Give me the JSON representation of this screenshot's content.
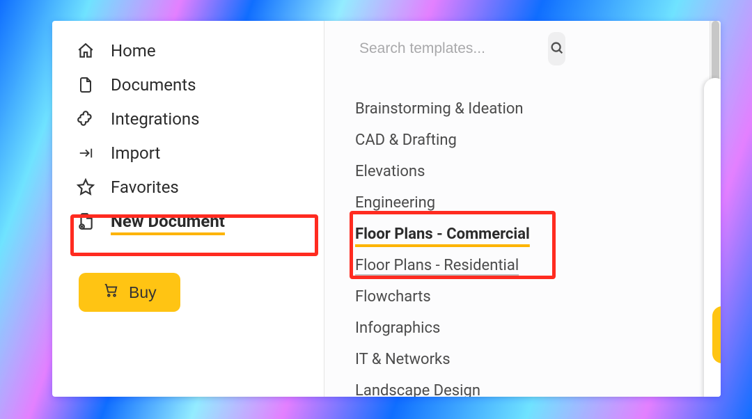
{
  "sidebar": {
    "items": [
      {
        "label": "Home",
        "icon": "home-icon"
      },
      {
        "label": "Documents",
        "icon": "documents-icon"
      },
      {
        "label": "Integrations",
        "icon": "integrations-icon"
      },
      {
        "label": "Import",
        "icon": "import-icon"
      },
      {
        "label": "Favorites",
        "icon": "favorites-icon"
      },
      {
        "label": "New Document",
        "icon": "new-document-icon",
        "active": true
      }
    ],
    "buy_label": "Buy"
  },
  "search": {
    "placeholder": "Search templates..."
  },
  "categories": [
    {
      "label": "Brainstorming & Ideation"
    },
    {
      "label": "CAD & Drafting"
    },
    {
      "label": "Elevations"
    },
    {
      "label": "Engineering"
    },
    {
      "label": "Floor Plans - Commercial",
      "active": true
    },
    {
      "label": "Floor Plans - Residential",
      "sub_underlined": true
    },
    {
      "label": "Flowcharts"
    },
    {
      "label": "Infographics"
    },
    {
      "label": "IT & Networks"
    },
    {
      "label": "Landscape Design"
    }
  ],
  "highlights": {
    "sidebar_box_on": "New Document",
    "category_box_on": [
      "Floor Plans - Commercial",
      "Floor Plans - Residential"
    ]
  },
  "colors": {
    "accent": "#fec431",
    "highlight_box": "#e43229",
    "underline": "#f1b400"
  }
}
